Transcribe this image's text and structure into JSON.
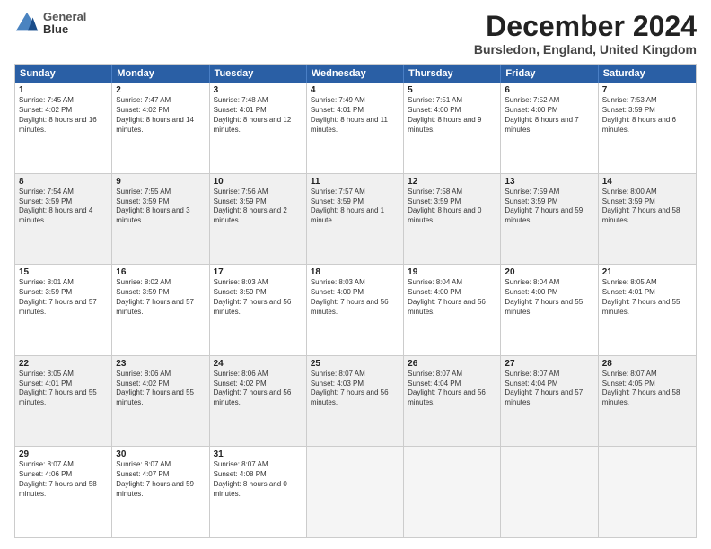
{
  "header": {
    "logo_line1": "General",
    "logo_line2": "Blue",
    "title": "December 2024",
    "subtitle": "Bursledon, England, United Kingdom"
  },
  "days_of_week": [
    "Sunday",
    "Monday",
    "Tuesday",
    "Wednesday",
    "Thursday",
    "Friday",
    "Saturday"
  ],
  "weeks": [
    [
      {
        "day": "1",
        "info": "Sunrise: 7:45 AM\nSunset: 4:02 PM\nDaylight: 8 hours and 16 minutes."
      },
      {
        "day": "2",
        "info": "Sunrise: 7:47 AM\nSunset: 4:02 PM\nDaylight: 8 hours and 14 minutes."
      },
      {
        "day": "3",
        "info": "Sunrise: 7:48 AM\nSunset: 4:01 PM\nDaylight: 8 hours and 12 minutes."
      },
      {
        "day": "4",
        "info": "Sunrise: 7:49 AM\nSunset: 4:01 PM\nDaylight: 8 hours and 11 minutes."
      },
      {
        "day": "5",
        "info": "Sunrise: 7:51 AM\nSunset: 4:00 PM\nDaylight: 8 hours and 9 minutes."
      },
      {
        "day": "6",
        "info": "Sunrise: 7:52 AM\nSunset: 4:00 PM\nDaylight: 8 hours and 7 minutes."
      },
      {
        "day": "7",
        "info": "Sunrise: 7:53 AM\nSunset: 3:59 PM\nDaylight: 8 hours and 6 minutes."
      }
    ],
    [
      {
        "day": "8",
        "info": "Sunrise: 7:54 AM\nSunset: 3:59 PM\nDaylight: 8 hours and 4 minutes."
      },
      {
        "day": "9",
        "info": "Sunrise: 7:55 AM\nSunset: 3:59 PM\nDaylight: 8 hours and 3 minutes."
      },
      {
        "day": "10",
        "info": "Sunrise: 7:56 AM\nSunset: 3:59 PM\nDaylight: 8 hours and 2 minutes."
      },
      {
        "day": "11",
        "info": "Sunrise: 7:57 AM\nSunset: 3:59 PM\nDaylight: 8 hours and 1 minute."
      },
      {
        "day": "12",
        "info": "Sunrise: 7:58 AM\nSunset: 3:59 PM\nDaylight: 8 hours and 0 minutes."
      },
      {
        "day": "13",
        "info": "Sunrise: 7:59 AM\nSunset: 3:59 PM\nDaylight: 7 hours and 59 minutes."
      },
      {
        "day": "14",
        "info": "Sunrise: 8:00 AM\nSunset: 3:59 PM\nDaylight: 7 hours and 58 minutes."
      }
    ],
    [
      {
        "day": "15",
        "info": "Sunrise: 8:01 AM\nSunset: 3:59 PM\nDaylight: 7 hours and 57 minutes."
      },
      {
        "day": "16",
        "info": "Sunrise: 8:02 AM\nSunset: 3:59 PM\nDaylight: 7 hours and 57 minutes."
      },
      {
        "day": "17",
        "info": "Sunrise: 8:03 AM\nSunset: 3:59 PM\nDaylight: 7 hours and 56 minutes."
      },
      {
        "day": "18",
        "info": "Sunrise: 8:03 AM\nSunset: 4:00 PM\nDaylight: 7 hours and 56 minutes."
      },
      {
        "day": "19",
        "info": "Sunrise: 8:04 AM\nSunset: 4:00 PM\nDaylight: 7 hours and 56 minutes."
      },
      {
        "day": "20",
        "info": "Sunrise: 8:04 AM\nSunset: 4:00 PM\nDaylight: 7 hours and 55 minutes."
      },
      {
        "day": "21",
        "info": "Sunrise: 8:05 AM\nSunset: 4:01 PM\nDaylight: 7 hours and 55 minutes."
      }
    ],
    [
      {
        "day": "22",
        "info": "Sunrise: 8:05 AM\nSunset: 4:01 PM\nDaylight: 7 hours and 55 minutes."
      },
      {
        "day": "23",
        "info": "Sunrise: 8:06 AM\nSunset: 4:02 PM\nDaylight: 7 hours and 55 minutes."
      },
      {
        "day": "24",
        "info": "Sunrise: 8:06 AM\nSunset: 4:02 PM\nDaylight: 7 hours and 56 minutes."
      },
      {
        "day": "25",
        "info": "Sunrise: 8:07 AM\nSunset: 4:03 PM\nDaylight: 7 hours and 56 minutes."
      },
      {
        "day": "26",
        "info": "Sunrise: 8:07 AM\nSunset: 4:04 PM\nDaylight: 7 hours and 56 minutes."
      },
      {
        "day": "27",
        "info": "Sunrise: 8:07 AM\nSunset: 4:04 PM\nDaylight: 7 hours and 57 minutes."
      },
      {
        "day": "28",
        "info": "Sunrise: 8:07 AM\nSunset: 4:05 PM\nDaylight: 7 hours and 58 minutes."
      }
    ],
    [
      {
        "day": "29",
        "info": "Sunrise: 8:07 AM\nSunset: 4:06 PM\nDaylight: 7 hours and 58 minutes."
      },
      {
        "day": "30",
        "info": "Sunrise: 8:07 AM\nSunset: 4:07 PM\nDaylight: 7 hours and 59 minutes."
      },
      {
        "day": "31",
        "info": "Sunrise: 8:07 AM\nSunset: 4:08 PM\nDaylight: 8 hours and 0 minutes."
      },
      {
        "day": "",
        "info": ""
      },
      {
        "day": "",
        "info": ""
      },
      {
        "day": "",
        "info": ""
      },
      {
        "day": "",
        "info": ""
      }
    ]
  ]
}
